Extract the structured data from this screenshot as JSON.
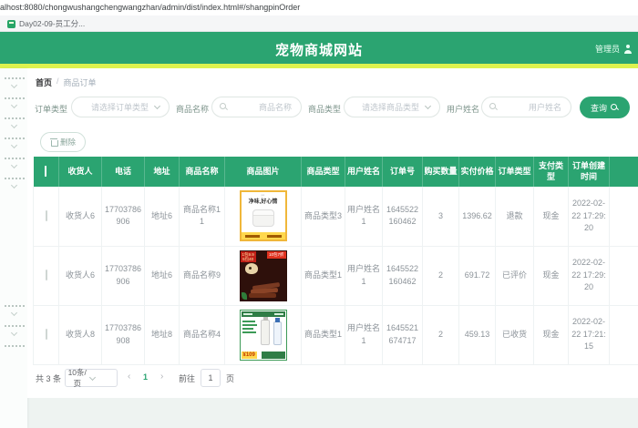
{
  "browser": {
    "url": "alhost:8080/chongwushangchengwangzhan/admin/dist/index.html#/shangpinOrder",
    "bookmark_label": "Day02-09-员工分..."
  },
  "header": {
    "title": "宠物商城网站",
    "user_label": "管理员"
  },
  "breadcrumb": {
    "home": "首页",
    "separator": "/",
    "current": "商品订单"
  },
  "filters": {
    "order_type_label": "订单类型",
    "order_type_placeholder": "请选择订单类型",
    "product_name_label": "商品名称",
    "product_name_placeholder": "商品名称",
    "product_type_label": "商品类型",
    "product_type_placeholder": "请选择商品类型",
    "user_name_label": "用户姓名",
    "user_name_placeholder": "用户姓名",
    "search_label": "查询"
  },
  "toolbar": {
    "delete_label": "删除"
  },
  "table": {
    "columns": [
      "收货人",
      "电话",
      "地址",
      "商品名称",
      "商品图片",
      "商品类型",
      "用户姓名",
      "订单号",
      "购买数量",
      "实付价格",
      "订单类型",
      "支付类型",
      "订单创建时间"
    ],
    "rows": [
      {
        "receiver": "收货人6",
        "phone": "17703786906",
        "address": "地址6",
        "product_name": "商品名称11",
        "image": {
          "kind": "cat-litter-ad",
          "title": "净味,好心情"
        },
        "product_type": "商品类型3",
        "user_name": "用户姓名1",
        "order_no": "1645522160462",
        "quantity": "3",
        "price": "1396.62",
        "order_type": "退款",
        "pay_type": "现金",
        "created": "2022-02-22 17:29:20"
      },
      {
        "receiver": "收货人6",
        "phone": "17703786906",
        "address": "地址6",
        "product_name": "商品名称9",
        "image": {
          "kind": "dog-treats-ad",
          "badge_left": "1包9.9\n5包40",
          "badge_right": "10包7折"
        },
        "product_type": "商品类型1",
        "user_name": "用户姓名1",
        "order_no": "1645522160462",
        "quantity": "2",
        "price": "691.72",
        "order_type": "已评价",
        "pay_type": "现金",
        "created": "2022-02-22 17:29:20"
      },
      {
        "receiver": "收货人8",
        "phone": "17703786908",
        "address": "地址8",
        "product_name": "商品名称4",
        "image": {
          "kind": "pet-care-bottles-ad",
          "price_tag": "¥109"
        },
        "product_type": "商品类型1",
        "user_name": "用户姓名1",
        "order_no": "1645521674717",
        "quantity": "2",
        "price": "459.13",
        "order_type": "已收货",
        "pay_type": "现金",
        "created": "2022-02-22 17:21:15"
      }
    ]
  },
  "pagination": {
    "total_label": "共 3 条",
    "page_size_label": "10条/页",
    "prev_icon": "‹",
    "next_icon": "›",
    "current_page": "1",
    "goto_label": "前往",
    "goto_value": "1",
    "goto_unit": "页"
  },
  "colors": {
    "primary_green": "#2ba471",
    "accent_yellow": "#ddf24e"
  }
}
